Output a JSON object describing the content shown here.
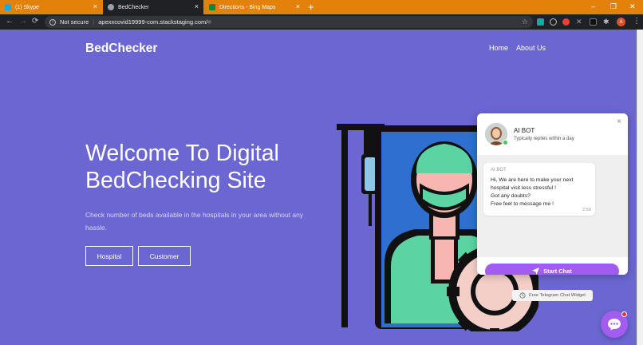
{
  "browser": {
    "tabs": [
      {
        "title": "(1) Skype",
        "favicon_color": "#00aff0",
        "active": false
      },
      {
        "title": "BedChecker",
        "favicon_color": "#9aa0a6",
        "active": true
      },
      {
        "title": "Directions - Bing Maps",
        "favicon_color": "#0a8a3a",
        "active": false
      }
    ],
    "new_tab": "+",
    "close_glyph": "×",
    "win_min": "–",
    "win_max": "❐",
    "win_close": "✕",
    "nav_back": "←",
    "nav_forward": "→",
    "nav_reload": "⟳",
    "security_text": "Not secure",
    "security_sep": "|",
    "url": "apexxcovid19999-com.stackstaging.com/",
    "url_hash": "#",
    "star": "☆",
    "profile_initial": "A",
    "kebab": "⋮"
  },
  "site": {
    "brand": "BedChecker",
    "menu": [
      "Home",
      "About Us"
    ],
    "hero_title": "Welcome To Digital BedChecking Site",
    "hero_subtitle": "Check number of beds available in the hospitals in your area without any hassle.",
    "buttons": [
      "Hospital",
      "Customer"
    ]
  },
  "chat": {
    "bot_name": "AI BOT",
    "status": "Typically replies within a day",
    "close": "×",
    "message_sender": "AI BOT",
    "message_lines": [
      "Hi, We are here to make your next",
      "hospital visit less stressful !",
      "Got any doubts?",
      "Free feel to message me !"
    ],
    "message_time": "2:59",
    "start_label": "Start Chat",
    "powered_label": "Free Telegram Chat Widget"
  },
  "colors": {
    "page_bg": "#6b66d1",
    "tabstrip": "#e2820a",
    "accent": "#a35cf0"
  }
}
